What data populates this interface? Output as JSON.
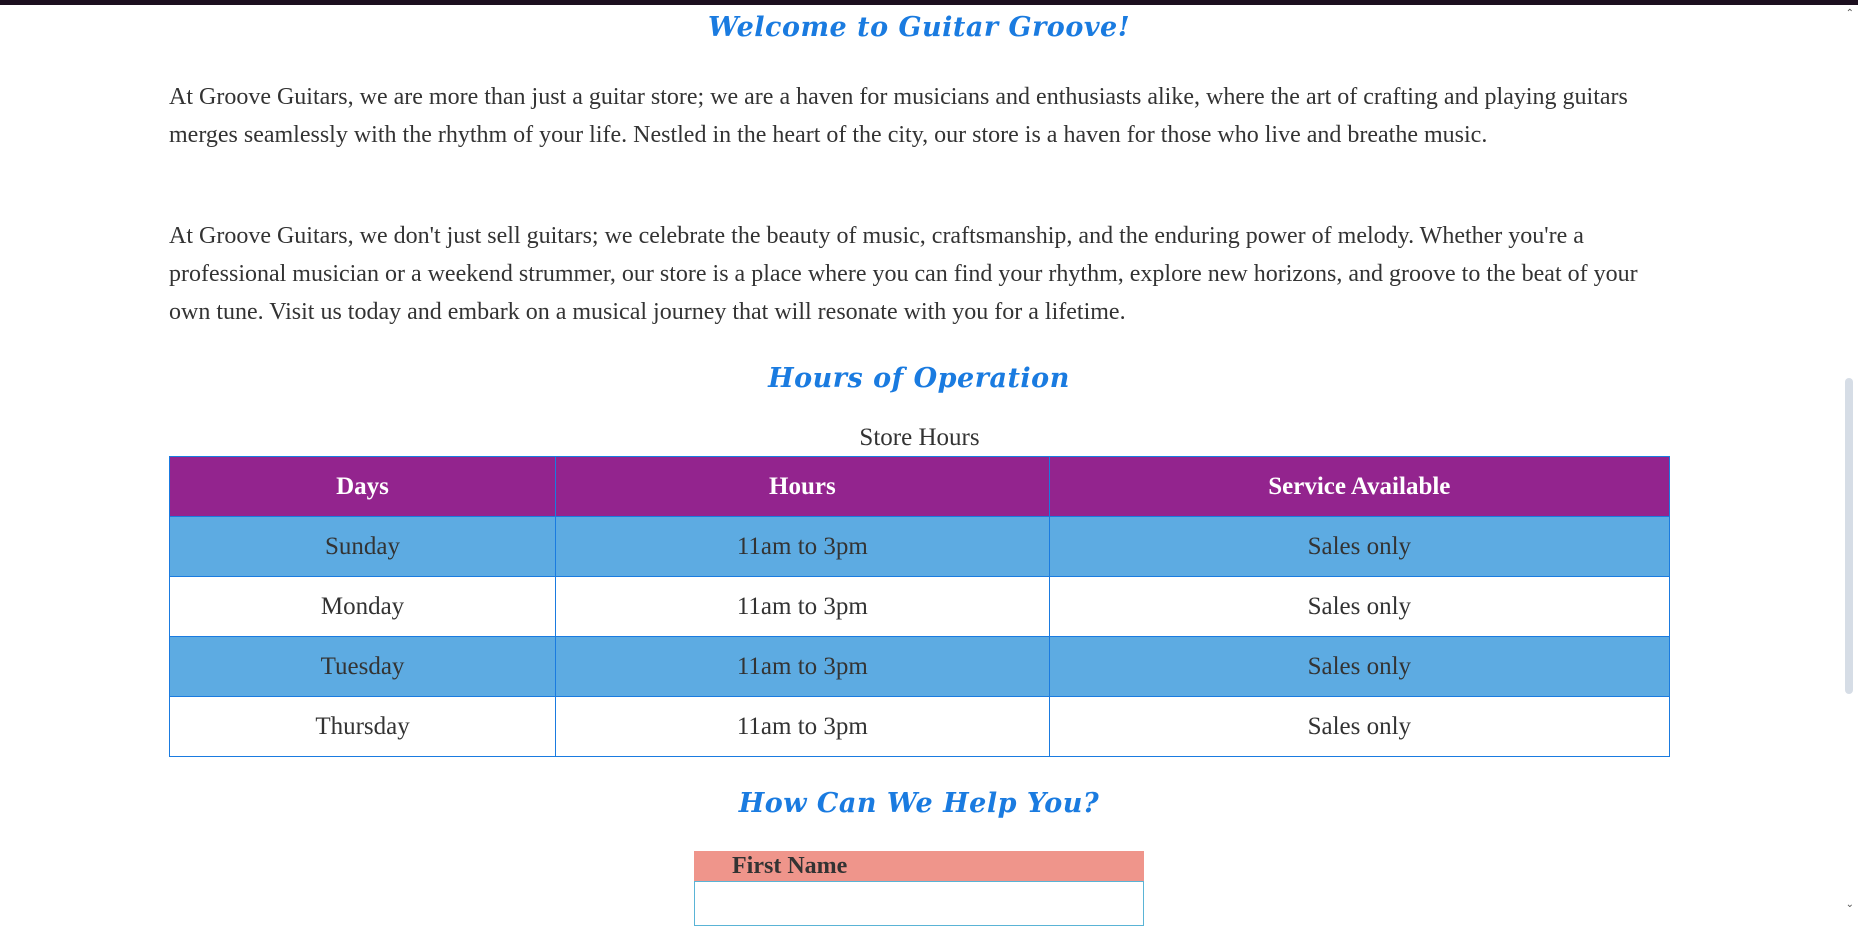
{
  "headings": {
    "welcome": "Welcome to Guitar Groove!",
    "hours": "Hours of Operation",
    "help": "How Can We Help You?"
  },
  "paragraphs": [
    "At Groove Guitars, we are more than just a guitar store; we are a haven for musicians and enthusiasts alike, where the art of crafting and playing guitars merges seamlessly with the rhythm of your life. Nestled in the heart of the city, our store is a haven for those who live and breathe music.",
    "At Groove Guitars, we don't just sell guitars; we celebrate the beauty of music, craftsmanship, and the enduring power of melody. Whether you're a professional musician or a weekend strummer, our store is a place where you can find your rhythm, explore new horizons, and groove to the beat of your own tune. Visit us today and embark on a musical journey that will resonate with you for a lifetime."
  ],
  "hours_table": {
    "caption": "Store Hours",
    "headers": [
      "Days",
      "Hours",
      "Service Available"
    ],
    "rows": [
      [
        "Sunday",
        "11am to 3pm",
        "Sales only"
      ],
      [
        "Monday",
        "11am to 3pm",
        "Sales only"
      ],
      [
        "Tuesday",
        "11am to 3pm",
        "Sales only"
      ],
      [
        "Thursday",
        "11am to 3pm",
        "Sales only"
      ]
    ]
  },
  "form": {
    "first_name_label": "First Name",
    "first_name_value": ""
  },
  "colors": {
    "heading": "#1a7be0",
    "table_header": "#93248e",
    "table_shaded_row": "#5dabe2",
    "form_label_bg": "#ef958b"
  }
}
